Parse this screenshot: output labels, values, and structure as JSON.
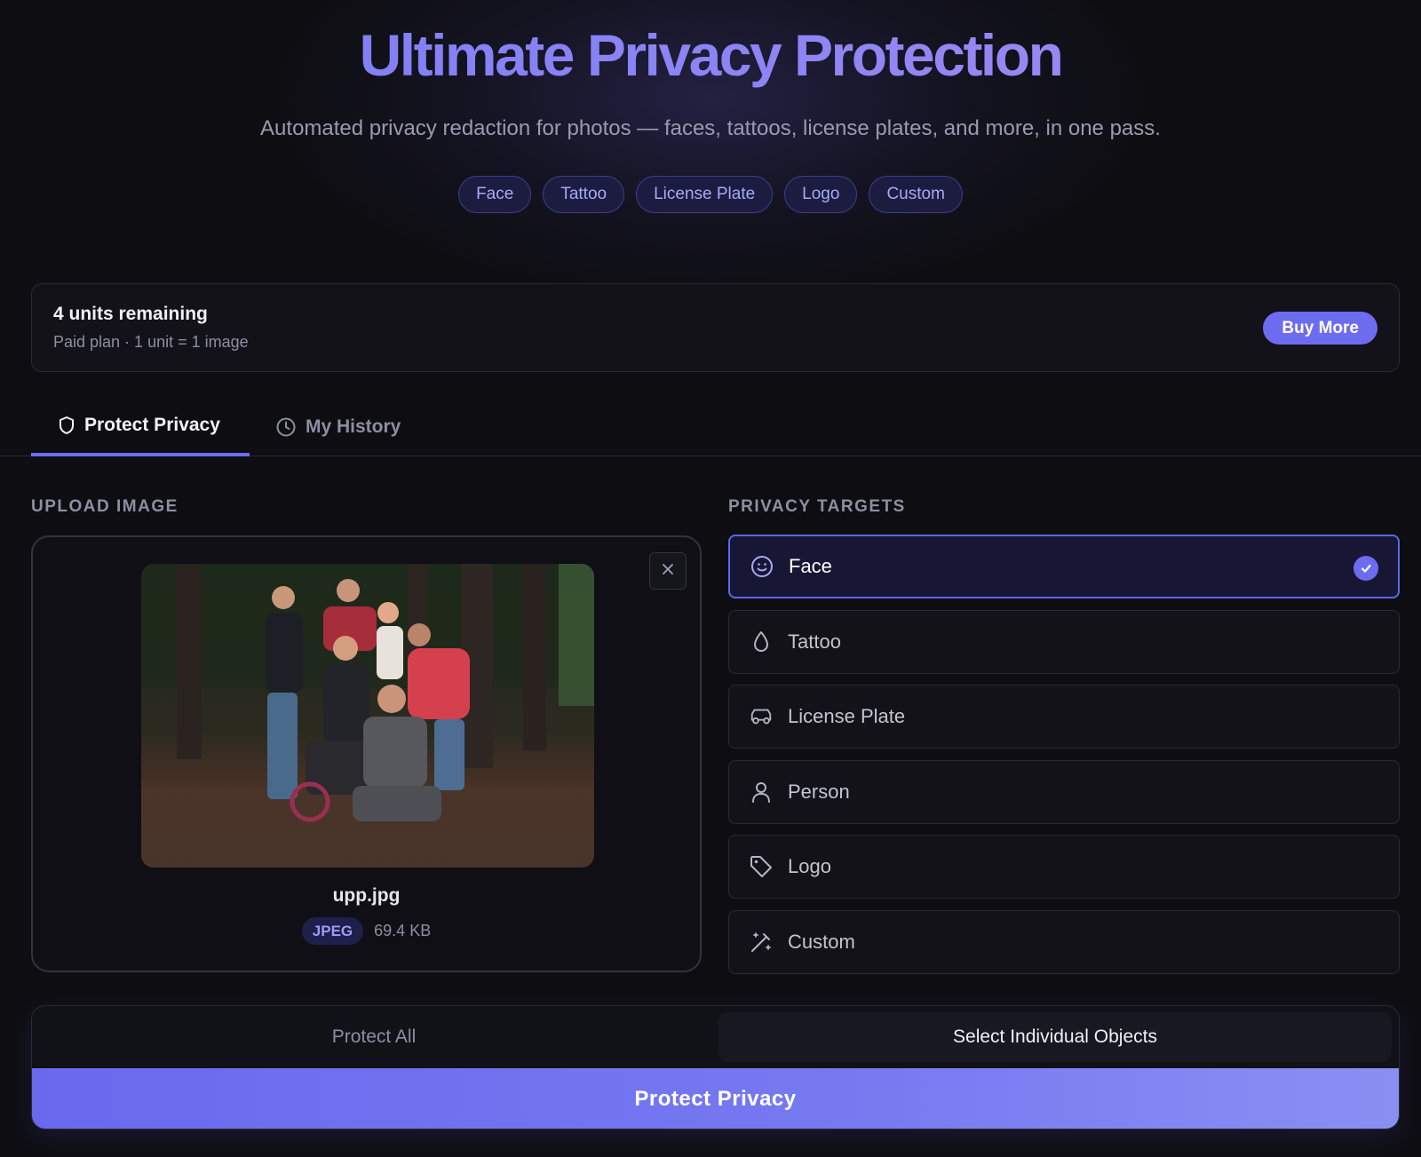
{
  "hero": {
    "title": "Ultimate Privacy Protection",
    "subtitle": "Automated privacy redaction for photos — faces, tattoos, license plates, and more, in one pass.",
    "chips": [
      "Face",
      "Tattoo",
      "License Plate",
      "Logo",
      "Custom"
    ]
  },
  "units": {
    "title": "4 units remaining",
    "subtitle": "Paid plan · 1 unit = 1 image",
    "buy_label": "Buy More"
  },
  "tabs": {
    "protect": "Protect Privacy",
    "history": "My History"
  },
  "upload": {
    "label": "UPLOAD IMAGE",
    "file_name": "upp.jpg",
    "file_type": "JPEG",
    "file_size": "69.4 KB"
  },
  "targets": {
    "label": "PRIVACY TARGETS",
    "items": [
      {
        "label": "Face",
        "icon": "smile-icon",
        "selected": true
      },
      {
        "label": "Tattoo",
        "icon": "droplet-icon",
        "selected": false
      },
      {
        "label": "License Plate",
        "icon": "car-icon",
        "selected": false
      },
      {
        "label": "Person",
        "icon": "user-icon",
        "selected": false
      },
      {
        "label": "Logo",
        "icon": "tag-icon",
        "selected": false
      },
      {
        "label": "Custom",
        "icon": "magic-wand-icon",
        "selected": false
      }
    ]
  },
  "mode": {
    "protect_all": "Protect All",
    "select_individual": "Select Individual Objects",
    "selected": "select_individual"
  },
  "action": {
    "protect_label": "Protect Privacy"
  },
  "colors": {
    "accent": "#6d6cf0",
    "background": "#0e0e12",
    "chip_text": "#a7a9f7"
  }
}
